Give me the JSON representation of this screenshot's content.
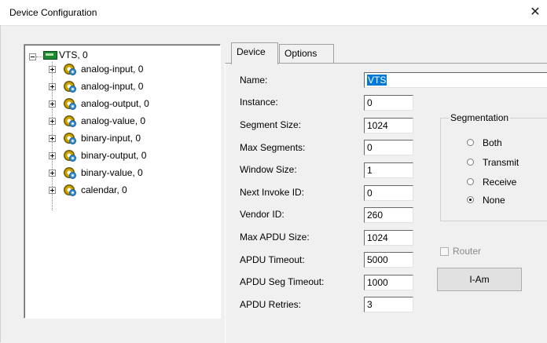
{
  "window": {
    "title": "Device Configuration",
    "close_glyph": "✕"
  },
  "tree": {
    "root": {
      "label": "VTS, 0",
      "icon": "device-icon"
    },
    "children": [
      {
        "label": "analog-input, 0",
        "icon": "gears-icon"
      },
      {
        "label": "analog-input, 0",
        "icon": "gears-icon"
      },
      {
        "label": "analog-output, 0",
        "icon": "gears-icon"
      },
      {
        "label": "analog-value, 0",
        "icon": "gears-icon"
      },
      {
        "label": "binary-input, 0",
        "icon": "gears-icon"
      },
      {
        "label": "binary-output, 0",
        "icon": "gears-icon"
      },
      {
        "label": "binary-value, 0",
        "icon": "gears-icon"
      },
      {
        "label": "calendar, 0",
        "icon": "gears-icon"
      }
    ]
  },
  "tabs": [
    {
      "label": "Device",
      "active": true
    },
    {
      "label": "Options",
      "active": false
    }
  ],
  "fields": [
    {
      "label": "Name:",
      "value": "VTS"
    },
    {
      "label": "Instance:",
      "value": "0"
    },
    {
      "label": "Segment Size:",
      "value": "1024"
    },
    {
      "label": "Max Segments:",
      "value": "0"
    },
    {
      "label": "Window Size:",
      "value": "1"
    },
    {
      "label": "Next Invoke ID:",
      "value": "0"
    },
    {
      "label": "Vendor ID:",
      "value": "260"
    },
    {
      "label": "Max APDU Size:",
      "value": "1024"
    },
    {
      "label": "APDU Timeout:",
      "value": "5000"
    },
    {
      "label": "APDU Seg Timeout:",
      "value": "1000"
    },
    {
      "label": "APDU Retries:",
      "value": "3"
    }
  ],
  "segmentation": {
    "title": "Segmentation",
    "options": [
      {
        "label": "Both",
        "selected": false
      },
      {
        "label": "Transmit",
        "selected": false
      },
      {
        "label": "Receive",
        "selected": false
      },
      {
        "label": "None",
        "selected": true
      }
    ]
  },
  "router": {
    "label": "Router",
    "checked": false,
    "enabled": false
  },
  "iam_button": {
    "label": "I-Am"
  },
  "colors": {
    "selection": "#0078d7",
    "background": "#f0f0f0"
  }
}
